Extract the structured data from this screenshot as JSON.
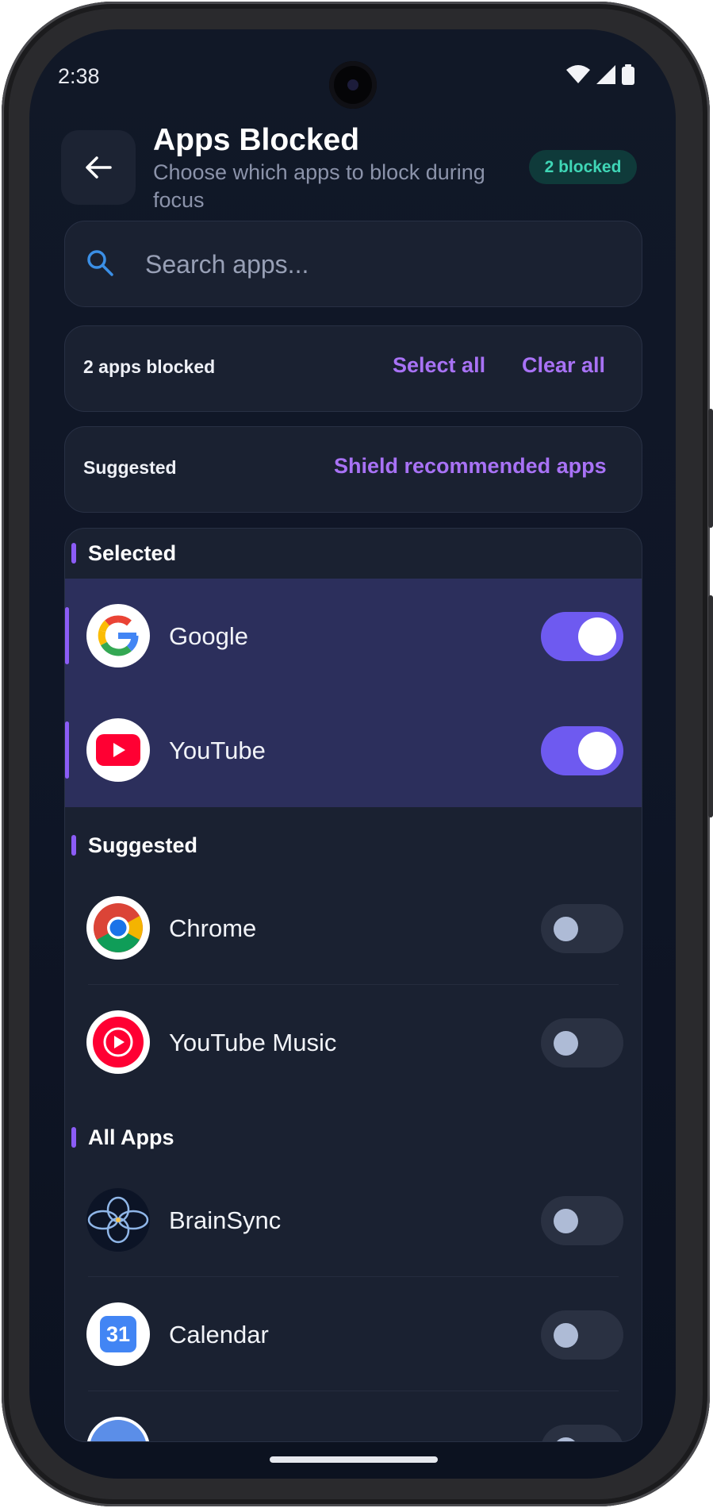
{
  "status_bar": {
    "time": "2:38"
  },
  "header": {
    "title": "Apps Blocked",
    "subtitle": "Choose which apps to block during focus",
    "badge": "2 blocked"
  },
  "search": {
    "placeholder": "Search apps..."
  },
  "blocked_bar": {
    "count_label": "2 apps blocked",
    "select_all": "Select all",
    "clear_all": "Clear all"
  },
  "suggested_bar": {
    "label": "Suggested",
    "action": "Shield recommended apps"
  },
  "sections": {
    "selected": {
      "title": "Selected",
      "apps": [
        {
          "name": "Google",
          "enabled": true
        },
        {
          "name": "YouTube",
          "enabled": true
        }
      ]
    },
    "suggested": {
      "title": "Suggested",
      "apps": [
        {
          "name": "Chrome",
          "enabled": false
        },
        {
          "name": "YouTube Music",
          "enabled": false
        }
      ]
    },
    "all_apps": {
      "title": "All Apps",
      "apps": [
        {
          "name": "BrainSync",
          "enabled": false
        },
        {
          "name": "Calendar",
          "enabled": false,
          "icon_text": "31"
        }
      ]
    }
  },
  "colors": {
    "accent": "#8b5cf6",
    "link": "#a872f5",
    "toggle_on": "#6e5af0",
    "badge_text": "#3fd6b6"
  }
}
